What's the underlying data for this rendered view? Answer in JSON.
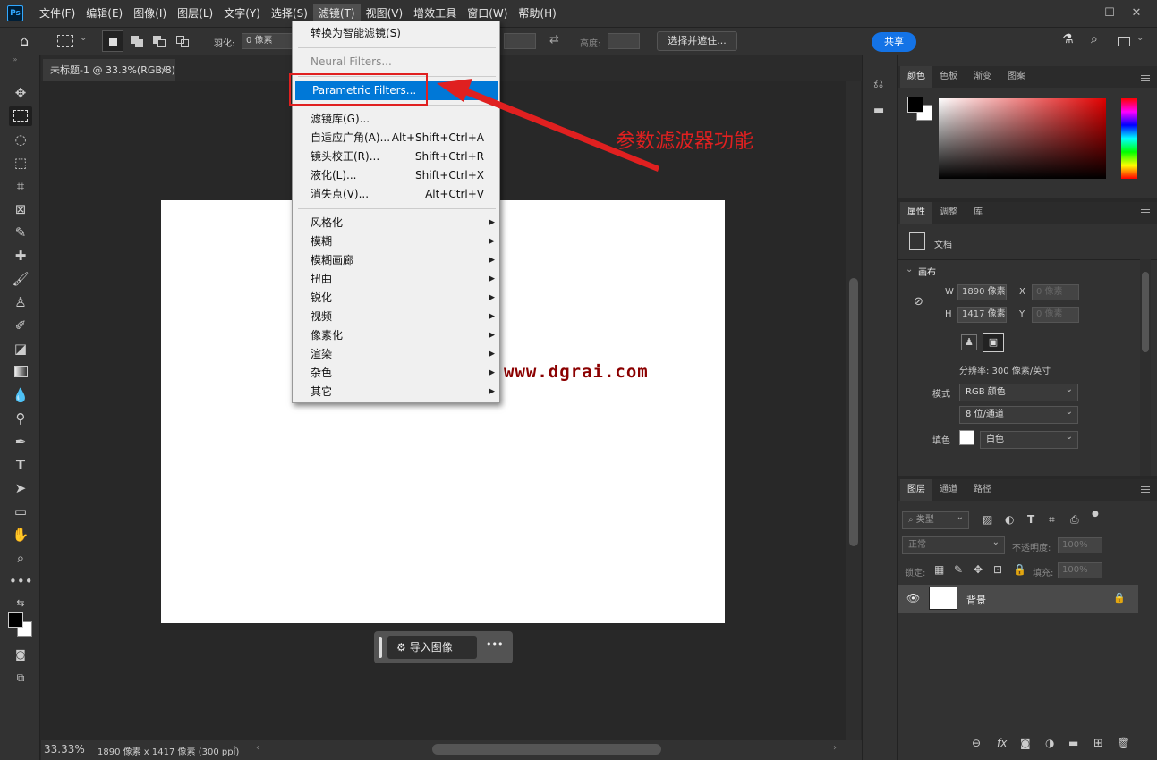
{
  "menubar": {
    "logo": "Ps",
    "items": [
      "文件(F)",
      "编辑(E)",
      "图像(I)",
      "图层(L)",
      "文字(Y)",
      "选择(S)",
      "滤镜(T)",
      "视图(V)",
      "增效工具",
      "窗口(W)",
      "帮助(H)"
    ],
    "win_controls": [
      "—",
      "☐",
      "✕"
    ]
  },
  "options": {
    "feather_label": "羽化:",
    "feather_value": "0 像素",
    "height_label": "高度:",
    "select_mask": "选择并遮住...",
    "share": "共享"
  },
  "doc": {
    "tab_title": "未标题-1 @ 33.3%(RGB/8)",
    "tab_close": "×",
    "watermark": "www.dgrai.com"
  },
  "status": {
    "zoom": "33.33%",
    "info": "1890 像素 x 1417 像素 (300 ppi)"
  },
  "taskbar": {
    "import": "导入图像",
    "more": "•••"
  },
  "dropdown": {
    "convert": "转换为智能滤镜(S)",
    "neural": "Neural Filters...",
    "parametric": "Parametric Filters...",
    "gallery": "滤镜库(G)...",
    "items_shortcuts": [
      [
        "自适应广角(A)...",
        "Alt+Shift+Ctrl+A"
      ],
      [
        "镜头校正(R)...",
        "Shift+Ctrl+R"
      ],
      [
        "液化(L)...",
        "Shift+Ctrl+X"
      ],
      [
        "消失点(V)...",
        "Alt+Ctrl+V"
      ]
    ],
    "submenus": [
      "风格化",
      "模糊",
      "模糊画廊",
      "扭曲",
      "锐化",
      "视频",
      "像素化",
      "渲染",
      "杂色",
      "其它"
    ]
  },
  "annotation": {
    "text": "参数滤波器功能",
    "color": "#e02020"
  },
  "color_panel": {
    "tabs": [
      "颜色",
      "色板",
      "渐变",
      "图案"
    ]
  },
  "props_panel": {
    "tabs": [
      "属性",
      "调整",
      "库"
    ],
    "doc_label": "文档",
    "canvas_label": "画布",
    "w_label": "W",
    "w_value": "1890 像素",
    "h_label": "H",
    "h_value": "1417 像素",
    "x_label": "X",
    "x_value": "0 像素",
    "y_label": "Y",
    "y_value": "0 像素",
    "resolution": "分辨率: 300 像素/英寸",
    "mode_label": "模式",
    "mode_value": "RGB 颜色",
    "depth_value": "8 位/通道",
    "fill_label": "填色",
    "fill_value": "白色"
  },
  "layers_panel": {
    "tabs": [
      "图层",
      "通道",
      "路径"
    ],
    "kind": "类型",
    "blend": "正常",
    "opacity_label": "不透明度:",
    "opacity_value": "100%",
    "lock_label": "锁定:",
    "fill_label": "填充:",
    "fill_value": "100%",
    "layer_name": "背景"
  },
  "colors": {
    "accent": "#1473e6",
    "highlight": "#0078d7",
    "annotation": "#e02020",
    "watermark": "#8b0000"
  }
}
